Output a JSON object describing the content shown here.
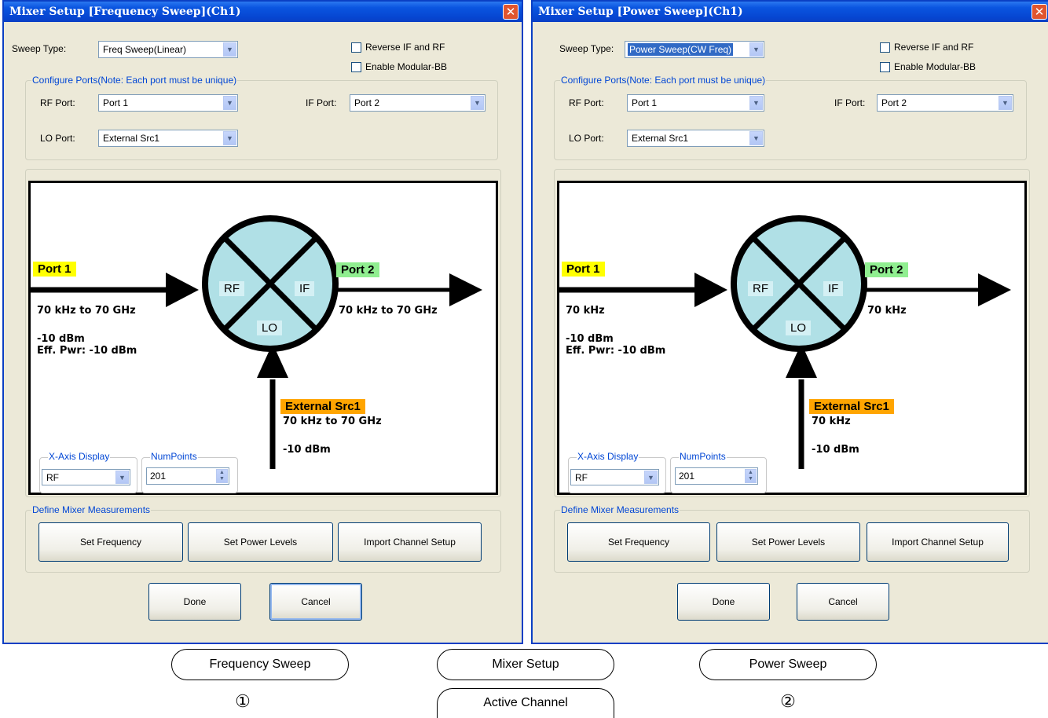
{
  "dialogs": [
    {
      "title": "Mixer Setup [Frequency Sweep](Ch1)",
      "sweep_type_label": "Sweep Type:",
      "sweep_type_value": "Freq Sweep(Linear)",
      "reverse_if_rf": "Reverse IF and RF",
      "enable_modular_bb": "Enable Modular-BB",
      "configure_ports_title": "Configure Ports(Note: Each port must be unique)",
      "rf_port_label": "RF Port:",
      "rf_port_value": "Port 1",
      "if_port_label": "IF Port:",
      "if_port_value": "Port 2",
      "lo_port_label": "LO Port:",
      "lo_port_value": "External Src1",
      "diagram": {
        "in_tag": "Port 1",
        "out_tag": "Port 2",
        "lo_tag": "External Src1",
        "mixer_rf": "RF",
        "mixer_if": "IF",
        "mixer_lo": "LO",
        "in_freq": "70 kHz to 70 GHz",
        "in_power": "-10 dBm",
        "in_eff_pwr": "Eff. Pwr: -10 dBm",
        "out_freq": "70 kHz to 70 GHz",
        "lo_freq": "70 kHz to 70 GHz",
        "lo_power": "-10 dBm"
      },
      "xaxis_title": "X-Axis Display",
      "xaxis_value": "RF",
      "numpoints_title": "NumPoints",
      "numpoints_value": "201",
      "define_title": "Define Mixer Measurements",
      "set_frequency": "Set Frequency",
      "set_power_levels": "Set Power Levels",
      "import_channel_setup": "Import Channel Setup",
      "done": "Done",
      "cancel": "Cancel"
    },
    {
      "title": "Mixer Setup [Power Sweep](Ch1)",
      "sweep_type_label": "Sweep Type:",
      "sweep_type_value": "Power Sweep(CW Freq)",
      "reverse_if_rf": "Reverse IF and RF",
      "enable_modular_bb": "Enable Modular-BB",
      "configure_ports_title": "Configure Ports(Note: Each port must be unique)",
      "rf_port_label": "RF Port:",
      "rf_port_value": "Port 1",
      "if_port_label": "IF Port:",
      "if_port_value": "Port 2",
      "lo_port_label": "LO Port:",
      "lo_port_value": "External Src1",
      "diagram": {
        "in_tag": "Port 1",
        "out_tag": "Port 2",
        "lo_tag": "External Src1",
        "mixer_rf": "RF",
        "mixer_if": "IF",
        "mixer_lo": "LO",
        "in_freq": "70 kHz",
        "in_power": "-10 dBm",
        "in_eff_pwr": "Eff. Pwr: -10 dBm",
        "out_freq": "70 kHz",
        "lo_freq": "70 kHz",
        "lo_power": "-10 dBm"
      },
      "xaxis_title": "X-Axis Display",
      "xaxis_value": "RF",
      "numpoints_title": "NumPoints",
      "numpoints_value": "201",
      "define_title": "Define Mixer Measurements",
      "set_frequency": "Set Frequency",
      "set_power_levels": "Set Power Levels",
      "import_channel_setup": "Import Channel Setup",
      "done": "Done",
      "cancel": "Cancel"
    }
  ],
  "callouts": {
    "frequency_sweep": "Frequency Sweep",
    "mixer_setup": "Mixer Setup",
    "power_sweep": "Power Sweep",
    "active_channel": "Active Channel",
    "num1": "①",
    "num2": "②"
  },
  "colors": {
    "port_in_tag": "#ffff00",
    "port_out_tag": "#90ee90",
    "lo_tag": "#ffa500",
    "mixer_fill": "#b0e0e6",
    "dialog_bg": "#ece9d8",
    "titlebar": "#0a55e0"
  },
  "icons": {
    "close": "close-icon",
    "dropdown": "chevron-down-icon",
    "spinner": "spinner-arrows-icon"
  }
}
